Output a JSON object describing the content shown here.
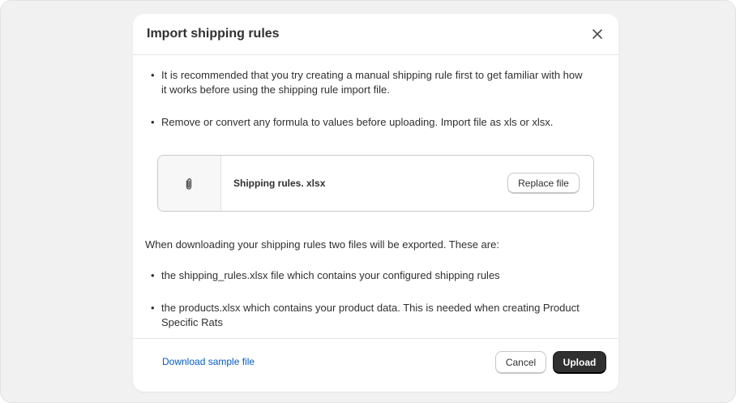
{
  "modal": {
    "title": "Import shipping rules",
    "close_icon": "close-icon"
  },
  "instructions": [
    {
      "line1": "It is recommended that you try creating a manual shipping rule first to get familiar with how",
      "line2": "it works before using the shipping rule import file."
    },
    {
      "line1": "Remove or convert any formula to values before uploading. Import file as xls or xlsx."
    }
  ],
  "file": {
    "icon": "paperclip-icon",
    "name": "Shipping rules. xlsx",
    "replace_label": "Replace file"
  },
  "export_info": {
    "intro": "When downloading your shipping rules two files will be exported. These are:",
    "items": [
      {
        "line1": "the shipping_rules.xlsx file which contains your configured shipping rules"
      },
      {
        "line1": "the products.xlsx which contains your product data. This is needed when creating Product",
        "line2": "Specific Rats"
      }
    ]
  },
  "footer": {
    "download_label": "Download sample file",
    "cancel_label": "Cancel",
    "upload_label": "Upload"
  },
  "colors": {
    "link": "#005bd3",
    "primary_button": "#303030",
    "backdrop": "#f1f1f2"
  }
}
